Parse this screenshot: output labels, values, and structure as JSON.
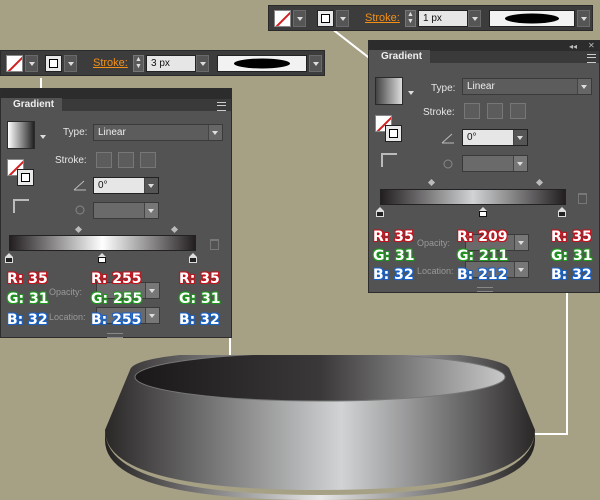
{
  "colors": {
    "background": "#a6a085",
    "panel": "#535353",
    "stroke_label": "#f29018",
    "red": "#c0141e",
    "green": "#1d9a1d",
    "blue": "#1c62c4"
  },
  "control_bar_left": {
    "stroke_label": "Stroke:",
    "stroke_weight": "3 px"
  },
  "control_bar_right": {
    "stroke_label": "Stroke:",
    "stroke_weight": "1 px"
  },
  "gradient_panel_left": {
    "title": "Gradient",
    "type_label": "Type:",
    "type_value": "Linear",
    "stroke_label": "Stroke:",
    "angle_value": "0°",
    "opacity_label": "Opacity:",
    "location_label": "Location:",
    "stops": [
      {
        "r_label": "R: 35",
        "g_label": "G: 31",
        "b_label": "B: 32"
      },
      {
        "r_label": "R: 255",
        "g_label": "G: 255",
        "b_label": "B: 255"
      },
      {
        "r_label": "R: 35",
        "g_label": "G: 31",
        "b_label": "B: 32"
      }
    ]
  },
  "gradient_panel_right": {
    "title": "Gradient",
    "type_label": "Type:",
    "type_value": "Linear",
    "stroke_label": "Stroke:",
    "angle_value": "0°",
    "opacity_label": "Opacity:",
    "location_label": "Location:",
    "stops": [
      {
        "r_label": "R: 35",
        "g_label": "G: 31",
        "b_label": "B: 32"
      },
      {
        "r_label": "R: 209",
        "g_label": "G: 211",
        "b_label": "B: 212"
      },
      {
        "r_label": "R: 35",
        "g_label": "G: 31",
        "b_label": "B: 32"
      }
    ]
  }
}
